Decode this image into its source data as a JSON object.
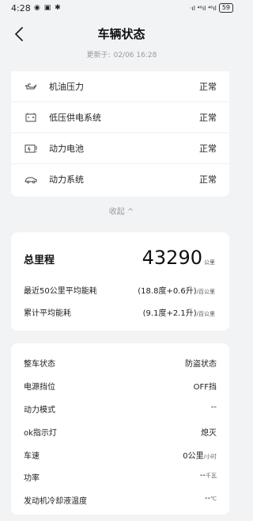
{
  "status_bar": {
    "time": "4:28",
    "left_icons": "◉ ▣ ✱",
    "signal": "·ıl ⁴⁶ıl ⁴⁶ıl",
    "battery": "59"
  },
  "header": {
    "title": "车辆状态",
    "updated_label": "更新于:",
    "updated_time": "02/06 16:28"
  },
  "status_items": [
    {
      "icon": "oil-can-icon",
      "label": "机油压力",
      "value": "正常"
    },
    {
      "icon": "battery-low-voltage-icon",
      "label": "低压供电系统",
      "value": "正常"
    },
    {
      "icon": "power-battery-icon",
      "label": "动力电池",
      "value": "正常"
    },
    {
      "icon": "car-power-system-icon",
      "label": "动力系统",
      "value": "正常"
    }
  ],
  "collapse_label": "收起 ^",
  "mileage": {
    "total_label": "总里程",
    "total_value": "43290",
    "total_unit": "公里",
    "recent_label": "最近50公里平均能耗",
    "recent_value": "(18.8度+0.6升)",
    "recent_unit": "/百公里",
    "cumulative_label": "累计平均能耗",
    "cumulative_value": "(9.1度+2.1升)",
    "cumulative_unit": "/百公里"
  },
  "vehicle": {
    "anti_theft_label": "整车状态",
    "anti_theft_value": "防盗状态",
    "power_gear_label": "电源挡位",
    "power_gear_value": "OFF挡",
    "power_mode_label": "动力模式",
    "power_mode_value": "--",
    "ok_light_label": "ok指示灯",
    "ok_light_value": "熄灭",
    "speed_label": "车速",
    "speed_value": "0公里",
    "speed_unit": "/小时",
    "power_label": "功率",
    "power_value": "--",
    "power_unit": "千瓦",
    "coolant_label": "发动机冷却液温度",
    "coolant_value": "--",
    "coolant_unit": "℃"
  }
}
